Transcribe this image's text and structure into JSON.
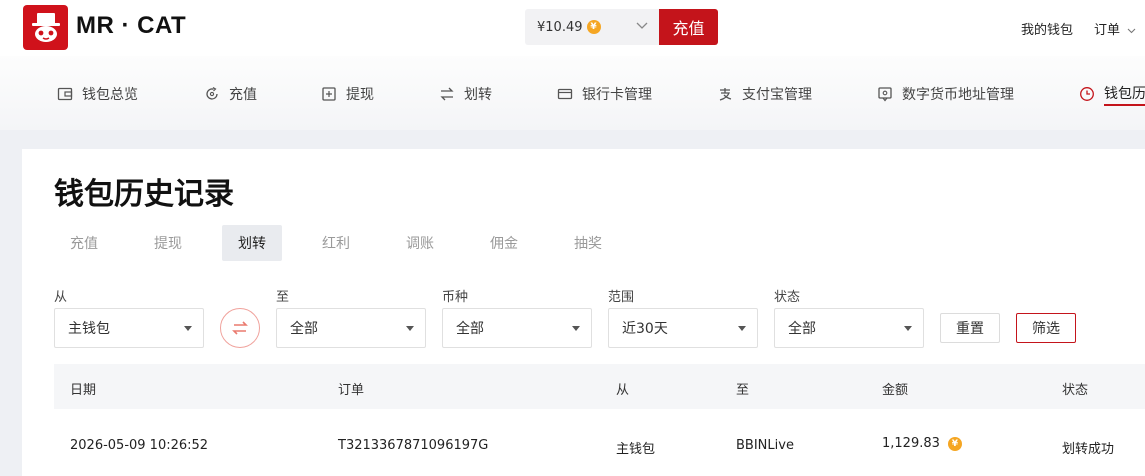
{
  "header": {
    "brand": "MR · CAT",
    "balance": "¥10.49",
    "coin_symbol": "¥",
    "topup_label": "充值",
    "wallet_link": "我的钱包",
    "orders_link": "订单",
    "brand_color": "#c4141b"
  },
  "nav": {
    "items": [
      {
        "label": "钱包总览",
        "icon": "wallet-icon"
      },
      {
        "label": "充值",
        "icon": "refresh-coin-icon"
      },
      {
        "label": "提现",
        "icon": "withdraw-icon"
      },
      {
        "label": "划转",
        "icon": "transfer-arrows-icon"
      },
      {
        "label": "银行卡管理",
        "icon": "card-icon"
      },
      {
        "label": "支付宝管理",
        "icon": "alipay-icon"
      },
      {
        "label": "数字货币地址管理",
        "icon": "location-icon"
      },
      {
        "label": "钱包历",
        "icon": "clock-icon"
      }
    ]
  },
  "main": {
    "title": "钱包历史记录",
    "tabs": [
      "充值",
      "提现",
      "划转",
      "红利",
      "调账",
      "佣金",
      "抽奖"
    ],
    "active_tab": "划转",
    "filters": {
      "from_label": "从",
      "from_value": "主钱包",
      "to_label": "至",
      "to_value": "全部",
      "currency_label": "币种",
      "currency_value": "全部",
      "range_label": "范围",
      "range_value": "近30天",
      "status_label": "状态",
      "status_value": "全部",
      "reset_label": "重置",
      "filter_label": "筛选"
    },
    "table": {
      "columns": [
        "日期",
        "订单",
        "从",
        "至",
        "金额",
        "状态"
      ],
      "rows": [
        {
          "date": "2026-05-09 10:26:52",
          "order": "T3213367871096197G",
          "from": "主钱包",
          "to": "BBINLive",
          "amount": "1,129.83",
          "status": "划转成功"
        }
      ]
    }
  }
}
